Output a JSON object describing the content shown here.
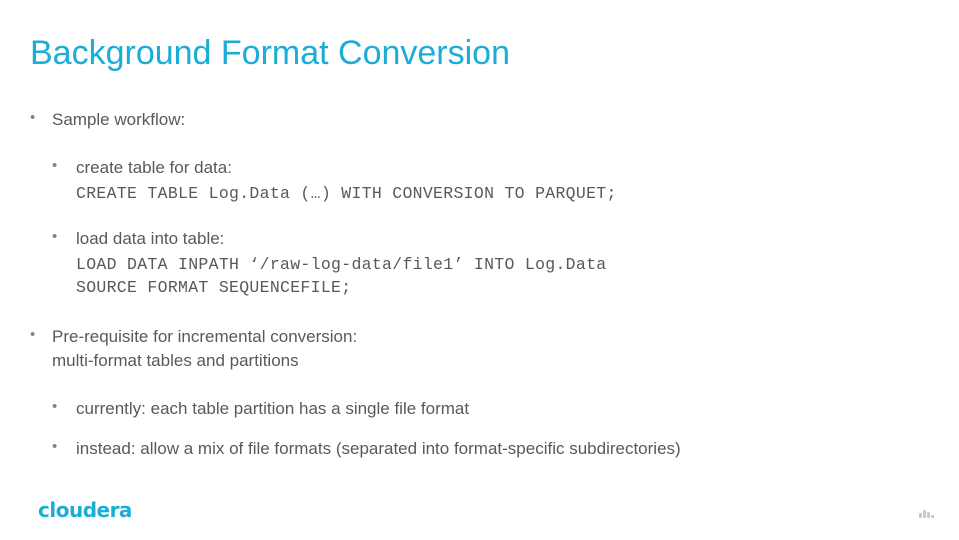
{
  "slide": {
    "title": "Background Format Conversion",
    "bullet_char": "•",
    "items": {
      "sample_workflow": "Sample workflow:",
      "create_table_label": "create table for data:",
      "create_table_code": "CREATE TABLE Log.Data (…) WITH CONVERSION TO PARQUET;",
      "load_data_label": "load data into table:",
      "load_data_code_line1": "LOAD DATA INPATH ‘/raw-log-data/file1’ INTO Log.Data",
      "load_data_code_line2": "SOURCE FORMAT SEQUENCEFILE;",
      "prereq_line1": "Pre-requisite for incremental conversion:",
      "prereq_line2": "multi-format tables and partitions",
      "currently": "currently: each table partition has a single file format",
      "instead": "instead: allow a mix of file formats (separated into format-specific subdirectories)"
    },
    "footer": {
      "logo_text": "cloudera",
      "page_mark": "bars-icon"
    },
    "colors": {
      "title": "#1badd6",
      "body_text": "#555a5e",
      "brand": "#1badd6"
    }
  }
}
